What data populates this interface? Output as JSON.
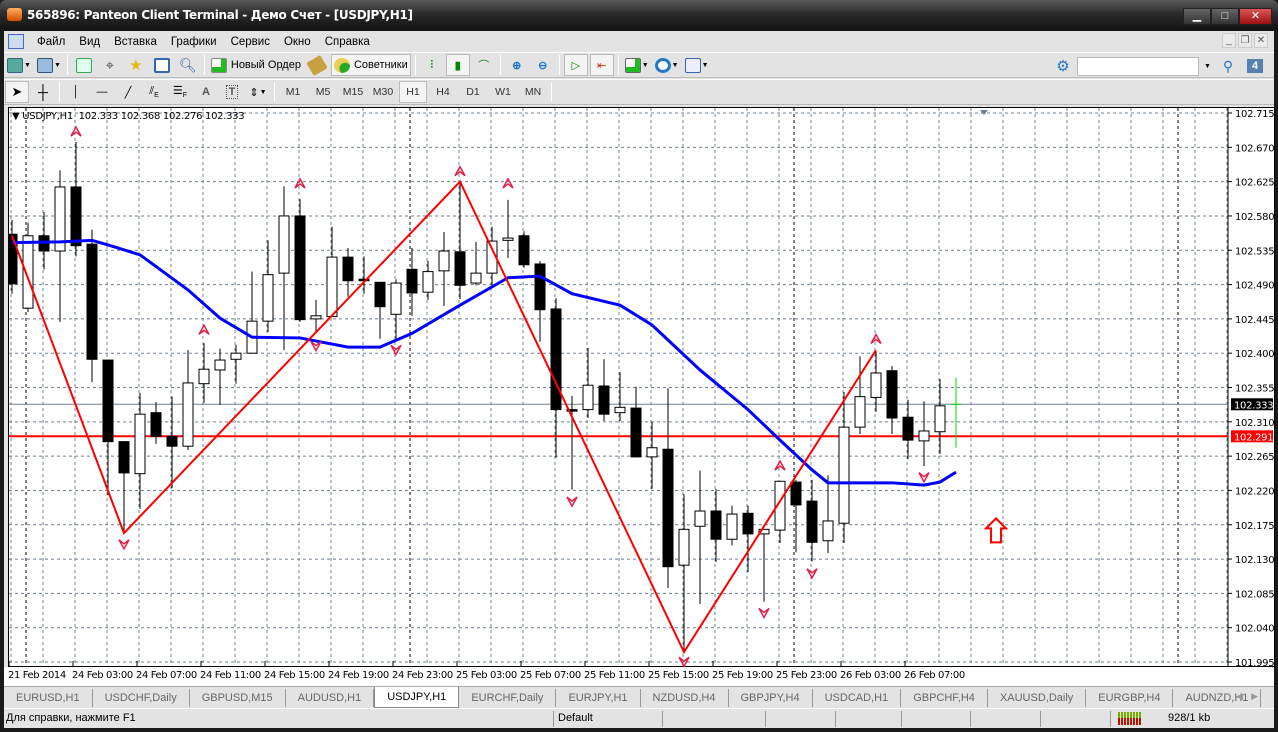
{
  "window": {
    "title": "565896: Panteon Client Terminal - Демо Счет - [USDJPY,H1]"
  },
  "menu": [
    "Файл",
    "Вид",
    "Вставка",
    "Графики",
    "Сервис",
    "Окно",
    "Справка"
  ],
  "toolbar": {
    "new_order": "Новый Ордер",
    "experts": "Советники"
  },
  "periods": [
    "M1",
    "M5",
    "M15",
    "M30",
    "H1",
    "H4",
    "D1",
    "W1",
    "MN"
  ],
  "active_period": "H1",
  "search": {
    "value": "",
    "badge": "4"
  },
  "chart": {
    "symbol": "USDJPY,H1",
    "ohlc_text": "102.333 102.368 102.276 102.333",
    "bid": "102.333",
    "line_level": "102.291",
    "colors": {
      "ma": "#0000ff",
      "zigzag": "#ff0000",
      "level": "#ff0000",
      "fractal": "#e0204a",
      "current_bar": "#00dd00"
    },
    "price_labels": [
      "102.715",
      "102.670",
      "102.625",
      "102.580",
      "102.535",
      "102.490",
      "102.445",
      "102.400",
      "102.355",
      "102.310",
      "102.265",
      "102.220",
      "102.175",
      "102.130",
      "102.085",
      "102.040",
      "101.995"
    ],
    "time_labels": [
      "21 Feb 2014",
      "24 Feb 03:00",
      "24 Feb 07:00",
      "24 Feb 11:00",
      "24 Feb 15:00",
      "24 Feb 19:00",
      "24 Feb 23:00",
      "25 Feb 03:00",
      "25 Feb 07:00",
      "25 Feb 11:00",
      "25 Feb 15:00",
      "25 Feb 19:00",
      "25 Feb 23:00",
      "26 Feb 03:00",
      "26 Feb 07:00"
    ]
  },
  "chart_data": {
    "type": "candlestick",
    "symbol": "USDJPY",
    "timeframe": "H1",
    "ylim": [
      101.995,
      102.715
    ],
    "candles": [
      [
        102.556,
        102.575,
        102.478,
        102.491
      ],
      [
        102.459,
        102.571,
        102.454,
        102.554
      ],
      [
        102.554,
        102.585,
        102.51,
        102.534
      ],
      [
        102.534,
        102.64,
        102.441,
        102.618
      ],
      [
        102.618,
        102.677,
        102.527,
        102.541
      ],
      [
        102.543,
        102.562,
        102.362,
        102.392
      ],
      [
        102.391,
        102.391,
        102.214,
        102.284
      ],
      [
        102.284,
        102.284,
        102.164,
        102.243
      ],
      [
        102.242,
        102.348,
        102.196,
        102.32
      ],
      [
        102.322,
        102.336,
        102.281,
        102.291
      ],
      [
        102.291,
        102.343,
        102.223,
        102.278
      ],
      [
        102.278,
        102.404,
        102.273,
        102.361
      ],
      [
        102.36,
        102.413,
        102.335,
        102.379
      ],
      [
        102.378,
        102.406,
        102.332,
        102.391
      ],
      [
        102.392,
        102.411,
        102.36,
        102.4
      ],
      [
        102.4,
        102.507,
        102.4,
        102.442
      ],
      [
        102.442,
        102.548,
        102.428,
        102.503
      ],
      [
        102.505,
        102.619,
        102.404,
        102.58
      ],
      [
        102.58,
        102.602,
        102.441,
        102.444
      ],
      [
        102.445,
        102.47,
        102.428,
        102.449
      ],
      [
        102.448,
        102.566,
        102.448,
        102.526
      ],
      [
        102.526,
        102.538,
        102.474,
        102.495
      ],
      [
        102.497,
        102.527,
        102.478,
        102.495
      ],
      [
        102.493,
        102.493,
        102.419,
        102.461
      ],
      [
        102.451,
        102.497,
        102.419,
        102.492
      ],
      [
        102.51,
        102.538,
        102.449,
        102.479
      ],
      [
        102.48,
        102.521,
        102.47,
        102.507
      ],
      [
        102.508,
        102.559,
        102.462,
        102.534
      ],
      [
        102.533,
        102.625,
        102.471,
        102.489
      ],
      [
        102.492,
        102.546,
        102.489,
        102.505
      ],
      [
        102.505,
        102.566,
        102.489,
        102.547
      ],
      [
        102.548,
        102.601,
        102.525,
        102.551
      ],
      [
        102.554,
        102.56,
        102.512,
        102.516
      ],
      [
        102.517,
        102.521,
        102.415,
        102.457
      ],
      [
        102.458,
        102.472,
        102.263,
        102.326
      ],
      [
        102.326,
        102.344,
        102.221,
        102.324
      ],
      [
        102.326,
        102.407,
        102.315,
        102.358
      ],
      [
        102.357,
        102.392,
        102.311,
        102.32
      ],
      [
        102.322,
        102.375,
        102.311,
        102.329
      ],
      [
        102.328,
        102.356,
        102.263,
        102.264
      ],
      [
        102.264,
        102.31,
        102.222,
        102.276
      ],
      [
        102.274,
        102.354,
        102.092,
        102.12
      ],
      [
        102.122,
        102.215,
        102.008,
        102.169
      ],
      [
        102.173,
        102.246,
        102.071,
        102.193
      ],
      [
        102.193,
        102.222,
        102.126,
        102.156
      ],
      [
        102.156,
        102.2,
        102.148,
        102.189
      ],
      [
        102.19,
        102.2,
        102.113,
        102.163
      ],
      [
        102.163,
        102.169,
        102.074,
        102.169
      ],
      [
        102.168,
        102.232,
        102.151,
        102.232
      ],
      [
        102.231,
        102.234,
        102.139,
        102.201
      ],
      [
        102.206,
        102.234,
        102.127,
        102.152
      ],
      [
        102.154,
        102.24,
        102.138,
        102.18
      ],
      [
        102.177,
        102.349,
        102.151,
        102.303
      ],
      [
        102.303,
        102.396,
        102.294,
        102.343
      ],
      [
        102.342,
        102.402,
        102.323,
        102.374
      ],
      [
        102.377,
        102.383,
        102.294,
        102.315
      ],
      [
        102.316,
        102.339,
        102.261,
        102.286
      ],
      [
        102.285,
        102.337,
        102.252,
        102.298
      ],
      [
        102.297,
        102.366,
        102.268,
        102.331
      ],
      [
        102.333,
        102.368,
        102.276,
        102.333
      ]
    ],
    "moving_average": [
      [
        0,
        102.545
      ],
      [
        3,
        102.546
      ],
      [
        5,
        102.548
      ],
      [
        6,
        102.542
      ],
      [
        8,
        102.529
      ],
      [
        11,
        102.483
      ],
      [
        13,
        102.446
      ],
      [
        15,
        102.421
      ],
      [
        18,
        102.42
      ],
      [
        21,
        102.408
      ],
      [
        23,
        102.408
      ],
      [
        25,
        102.426
      ],
      [
        28,
        102.463
      ],
      [
        31,
        102.499
      ],
      [
        33,
        102.501
      ],
      [
        35,
        102.478
      ],
      [
        38,
        102.463
      ],
      [
        40,
        102.437
      ],
      [
        43,
        102.378
      ],
      [
        46,
        102.326
      ],
      [
        48,
        102.286
      ],
      [
        50,
        102.247
      ],
      [
        51,
        102.23
      ],
      [
        55,
        102.23
      ],
      [
        57,
        102.227
      ],
      [
        58,
        102.231
      ],
      [
        59,
        102.244
      ]
    ],
    "zigzag": [
      [
        0,
        102.554
      ],
      [
        7,
        102.164
      ],
      [
        28,
        102.625
      ],
      [
        42,
        102.008
      ],
      [
        54,
        102.404
      ]
    ],
    "fractals_up": [
      [
        4,
        102.69
      ],
      [
        12,
        102.43
      ],
      [
        18,
        102.622
      ],
      [
        28,
        102.638
      ],
      [
        31,
        102.622
      ],
      [
        48,
        102.252
      ],
      [
        54,
        102.418
      ]
    ],
    "fractals_down": [
      [
        7,
        102.15
      ],
      [
        19,
        102.41
      ],
      [
        24,
        102.405
      ],
      [
        35,
        102.206
      ],
      [
        42,
        101.996
      ],
      [
        47,
        102.06
      ],
      [
        50,
        102.112
      ],
      [
        57,
        102.238
      ]
    ],
    "horizontal_lines": [
      102.291,
      102.333
    ],
    "day_separators": [
      1,
      25,
      49,
      73
    ],
    "arrow_object": [
      61,
      102.165
    ]
  },
  "tabs": [
    "EURUSD,H1",
    "USDCHF,Daily",
    "GBPUSD,M15",
    "AUDUSD,H1",
    "USDJPY,H1",
    "EURCHF,Daily",
    "EURJPY,H1",
    "NZDUSD,H4",
    "GBPJPY,H4",
    "USDCAD,H1",
    "GBPCHF,H4",
    "XAUUSD,Daily",
    "EURGBP,H4",
    "AUDNZD,H1"
  ],
  "active_tab": "USDJPY,H1",
  "status": {
    "help": "Для справки, нажмите F1",
    "profile": "Default",
    "traffic": "928/1 kb"
  }
}
